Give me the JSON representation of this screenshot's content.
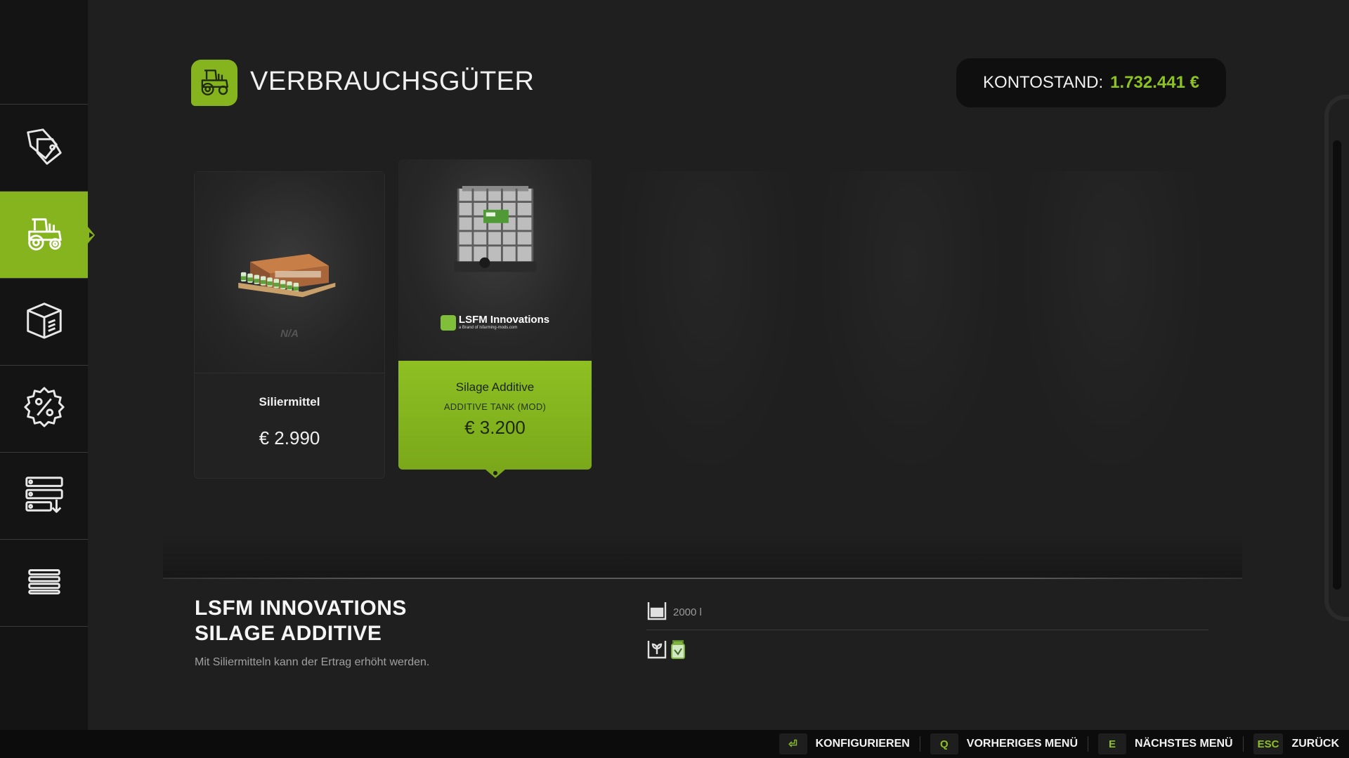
{
  "header": {
    "title": "VERBRAUCHSGÜTER",
    "balance_label": "KONTOSTAND:",
    "balance_value": "1.732.441 €"
  },
  "sidebar": {
    "items": [
      {
        "icon": "price-tag-icon",
        "active": false
      },
      {
        "icon": "tractor-icon",
        "active": true
      },
      {
        "icon": "box-icon",
        "active": false
      },
      {
        "icon": "discount-icon",
        "active": false
      },
      {
        "icon": "storage-icon",
        "active": false
      },
      {
        "icon": "list-icon",
        "active": false
      }
    ]
  },
  "cards": [
    {
      "name": "Siliermittel",
      "price": "€ 2.990",
      "brand": "N/A",
      "selected": false
    },
    {
      "name": "Silage Additive",
      "subtitle": "ADDITIVE TANK (MOD)",
      "price": "€ 3.200",
      "brand_name": "LSFM Innovations",
      "brand_tagline": "a Brand of lsfarming-mods.com",
      "selected": true
    }
  ],
  "detail": {
    "title_line1": "LSFM INNOVATIONS",
    "title_line2": "SILAGE ADDITIVE",
    "description": "Mit Siliermitteln kann der Ertrag erhöht werden.",
    "capacity": "2000 l"
  },
  "bottom_bar": [
    {
      "key": "⏎",
      "label": "KONFIGURIEREN"
    },
    {
      "key": "Q",
      "label": "VORHERIGES MENÜ"
    },
    {
      "key": "E",
      "label": "NÄCHSTES MENÜ"
    },
    {
      "key": "ESC",
      "label": "ZURÜCK"
    }
  ],
  "colors": {
    "accent": "#86b41f",
    "balance": "#8dc21f",
    "background": "#1f1f1f",
    "sidebar": "#141414"
  }
}
